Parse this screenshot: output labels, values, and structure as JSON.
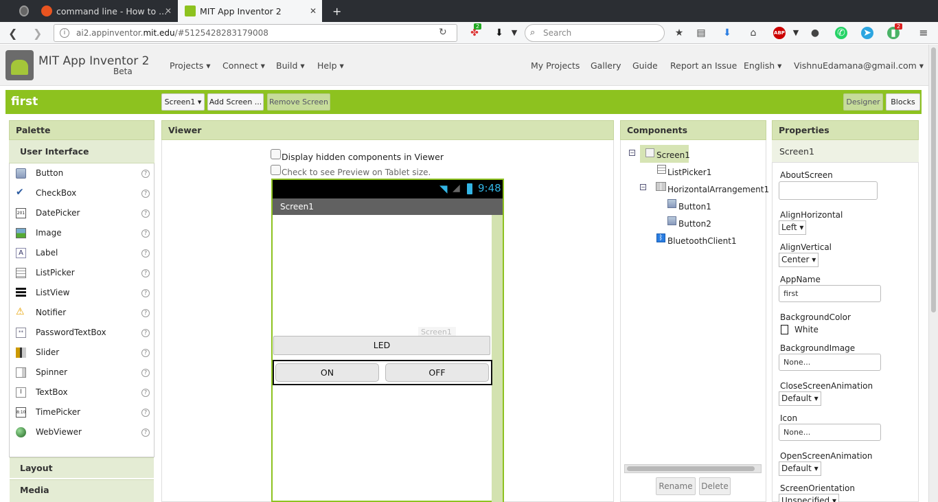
{
  "browser": {
    "tabs": [
      {
        "title": "command line - How to ...",
        "active": false
      },
      {
        "title": "MIT App Inventor 2",
        "active": true
      }
    ],
    "new_tab": "+",
    "url_path": "ai2.appinventor.",
    "url_host": "mit.edu",
    "url_hash": "/#5125428283179008",
    "search_placeholder": "Search",
    "badges": {
      "extensions": "2",
      "pushbullet": "2"
    }
  },
  "app": {
    "name": "MIT App Inventor 2",
    "edition": "Beta",
    "menus": [
      "Projects ▾",
      "Connect ▾",
      "Build ▾",
      "Help ▾"
    ],
    "right_links": [
      "My Projects",
      "Gallery",
      "Guide",
      "Report an Issue",
      "English ▾",
      "VishnuEdamana@gmail.com ▾"
    ]
  },
  "toolbar": {
    "project_name": "first",
    "screen_select": "Screen1 ▾",
    "add_screen": "Add Screen ...",
    "remove_screen": "Remove Screen",
    "designer": "Designer",
    "blocks": "Blocks"
  },
  "palette": {
    "title": "Palette",
    "category": "User Interface",
    "items": [
      "Button",
      "CheckBox",
      "DatePicker",
      "Image",
      "Label",
      "ListPicker",
      "ListView",
      "Notifier",
      "PasswordTextBox",
      "Slider",
      "Spinner",
      "TextBox",
      "TimePicker",
      "WebViewer"
    ],
    "help": "?",
    "collapsed": [
      "Layout",
      "Media"
    ]
  },
  "viewer": {
    "title": "Viewer",
    "check_hidden": "Display hidden components in Viewer",
    "check_tablet": "Check to see Preview on Tablet size.",
    "phone": {
      "time": "9:48",
      "screen_title": "Screen1",
      "watermark": "Screen1",
      "led_button": "LED",
      "on_button": "ON",
      "off_button": "OFF"
    }
  },
  "components": {
    "title": "Components",
    "tree": [
      "Screen1",
      "ListPicker1",
      "HorizontalArrangement1",
      "Button1",
      "Button2",
      "BluetoothClient1"
    ],
    "rename": "Rename",
    "delete": "Delete"
  },
  "properties": {
    "title": "Properties",
    "selected": "Screen1",
    "about_label": "AboutScreen",
    "align_h_label": "AlignHorizontal",
    "align_h_value": "Left ▾",
    "align_v_label": "AlignVertical",
    "align_v_value": "Center ▾",
    "appname_label": "AppName",
    "appname_value": "first",
    "bgcolor_label": "BackgroundColor",
    "bgcolor_value": "White",
    "bgimage_label": "BackgroundImage",
    "bgimage_value": "None...",
    "close_anim_label": "CloseScreenAnimation",
    "close_anim_value": "Default ▾",
    "icon_label": "Icon",
    "icon_value": "None...",
    "open_anim_label": "OpenScreenAnimation",
    "open_anim_value": "Default ▾",
    "orientation_label": "ScreenOrientation",
    "orientation_value": "Unspecified ▾"
  },
  "colors": {
    "accent_green": "#8dc21f",
    "panel_head": "#d6e4b4"
  }
}
